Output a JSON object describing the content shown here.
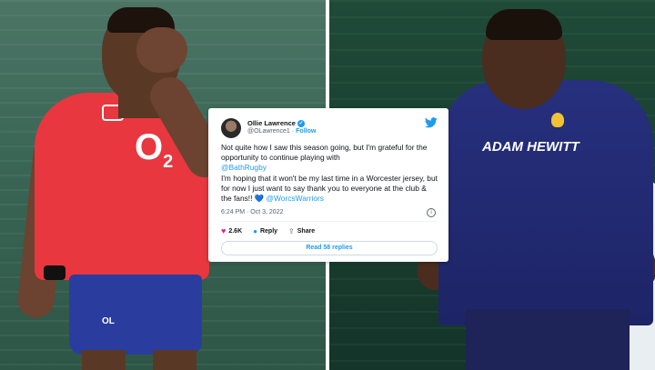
{
  "tweet": {
    "author_name": "Ollie Lawrence",
    "handle": "@OLawrence1",
    "follow_label": "Follow",
    "text_line_1": "Not quite how I saw this season going, but I'm grateful for the opportunity to continue playing with",
    "mention_1": "@BathRugby",
    "text_line_2": "I'm hoping that it won't be my last time in a Worcester jersey, but for now I just want to say thank you to everyone at the club & the fans!!",
    "heart_emoji": "💙",
    "mention_2": "@WorcsWarriors",
    "timestamp": "6:24 PM · Oct 3, 2022",
    "likes": "2.6K",
    "reply_label": "Reply",
    "share_label": "Share",
    "read_replies_label": "Read 58 replies"
  },
  "photo_left": {
    "shirt_text": "O",
    "shirt_sub": "2",
    "shorts_initials": "OL"
  },
  "photo_right": {
    "sponsor_text": "ADAM HEWITT"
  },
  "colors": {
    "twitter_blue": "#1d9bf0",
    "england_red": "#e8373f",
    "worcester_navy": "#27307e",
    "like_pink": "#f91880"
  },
  "icons": [
    "verified-badge-icon",
    "twitter-bird-icon",
    "info-icon",
    "heart-icon",
    "reply-icon",
    "share-icon"
  ]
}
